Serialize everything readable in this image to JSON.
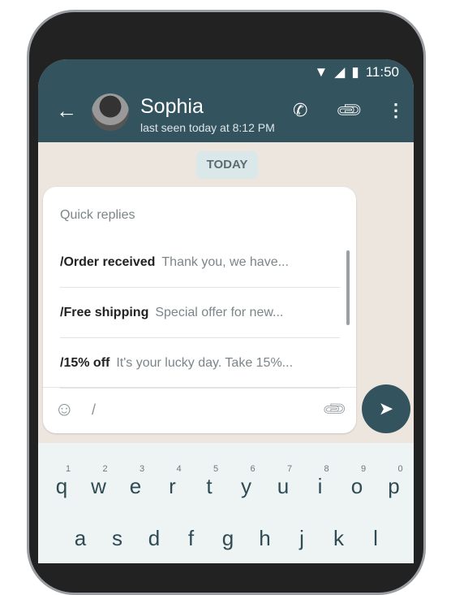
{
  "status": {
    "time": "11:50"
  },
  "header": {
    "name": "Sophia",
    "last_seen": "last seen today at 8:12 PM"
  },
  "date_chip": "TODAY",
  "quick_replies": {
    "title": "Quick replies",
    "items": [
      {
        "shortcut": "/Order received",
        "preview": "Thank you, we have..."
      },
      {
        "shortcut": "/Free shipping",
        "preview": "Special offer for new..."
      },
      {
        "shortcut": "/15% off",
        "preview": "It's your lucky day. Take 15%..."
      }
    ]
  },
  "input": {
    "value": "/"
  },
  "keyboard": {
    "row1": [
      "q",
      "w",
      "e",
      "r",
      "t",
      "y",
      "u",
      "i",
      "o",
      "p"
    ],
    "nums": [
      "1",
      "2",
      "3",
      "4",
      "5",
      "6",
      "7",
      "8",
      "9",
      "0"
    ],
    "row2": [
      "a",
      "s",
      "d",
      "f",
      "g",
      "h",
      "j",
      "k",
      "l"
    ]
  },
  "colors": {
    "header": "#33535f",
    "chat_bg": "#ece6df",
    "keyboard": "#eef3f3"
  }
}
